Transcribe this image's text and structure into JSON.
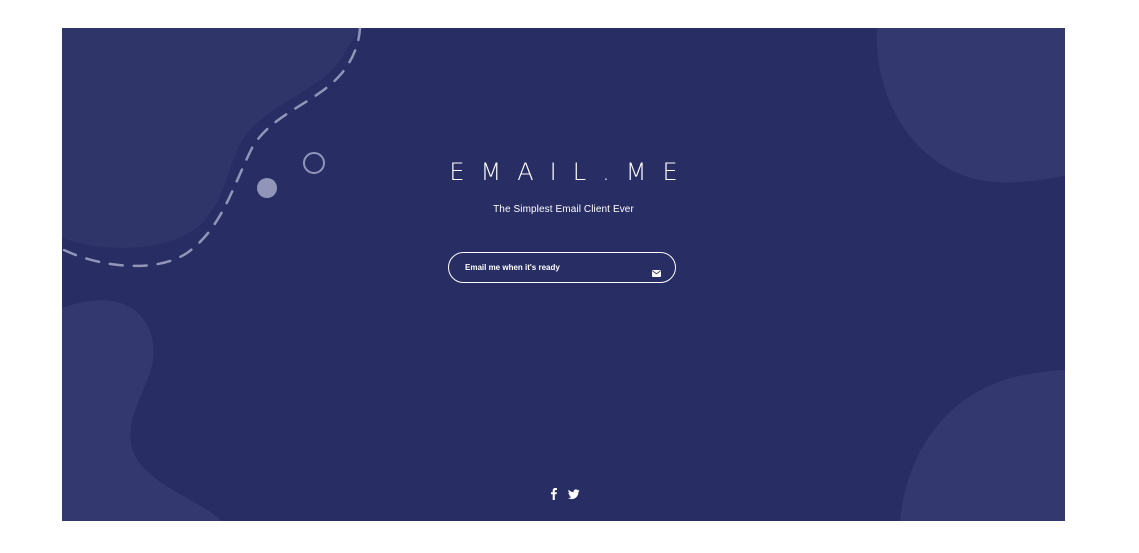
{
  "brand": {
    "title": "EMAIL.ME",
    "tagline": "The Simplest Email Client Ever"
  },
  "signup": {
    "label": "Email me when it's ready",
    "icon": "envelope-icon"
  },
  "social": {
    "links": [
      "facebook-icon",
      "twitter-icon"
    ]
  },
  "colors": {
    "background": "#282d63",
    "blob": "#33386e",
    "dashes": "#9196b8",
    "text": "#ffffff"
  }
}
